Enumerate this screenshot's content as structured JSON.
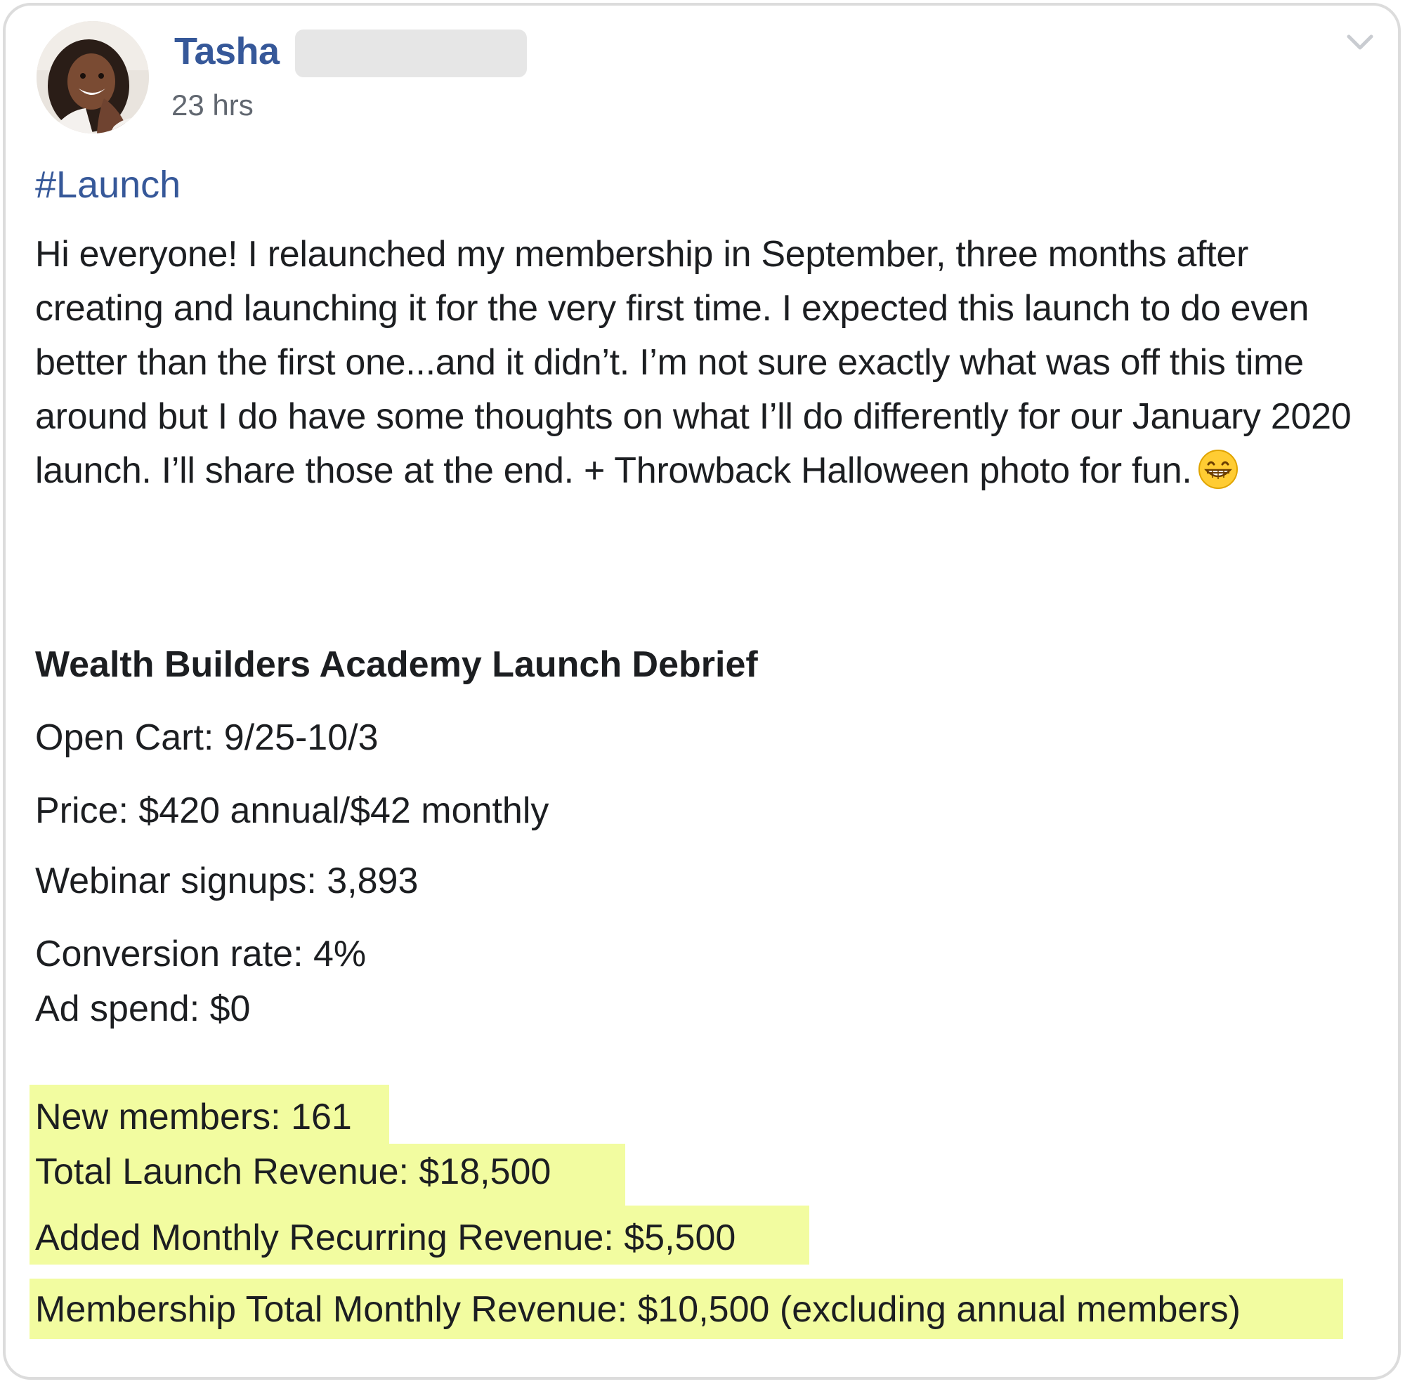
{
  "post": {
    "author_name": "Tasha",
    "timestamp": "23 hrs",
    "hashtag": "#Launch",
    "body": "Hi everyone! I relaunched my membership in September, three months after creating and launching it for the very first time. I expected this launch to do even better than the first one...and it didn’t. I’m not sure exactly what was off this time around but I do have some thoughts on what I’ll do differently for our January 2020 launch. I’ll share those at the end. + Throwback Halloween photo for fun.",
    "emoji_name": "grinning-face-with-smiling-eyes"
  },
  "debrief": {
    "title": "Wealth Builders Academy Launch Debrief",
    "open_cart": "Open Cart: 9/25-10/3",
    "price": "Price: $420 annual/$42 monthly",
    "webinar_signups": "Webinar signups: 3,893",
    "conversion_rate": "Conversion rate: 4%",
    "ad_spend": "Ad spend: $0",
    "new_members": "New members: 161",
    "total_launch_revenue": "Total Launch Revenue: $18,500",
    "added_mrr": "Added Monthly Recurring Revenue: $5,500",
    "membership_total_monthly": "Membership Total Monthly Revenue: $10,500 (excluding annual members)"
  },
  "colors": {
    "link_blue": "#365899",
    "highlight_yellow": "#f2fca0",
    "text": "#1c1e21",
    "meta_gray": "#616770"
  },
  "icons": {
    "options": "chevron-down-icon",
    "avatar": "profile-photo"
  }
}
